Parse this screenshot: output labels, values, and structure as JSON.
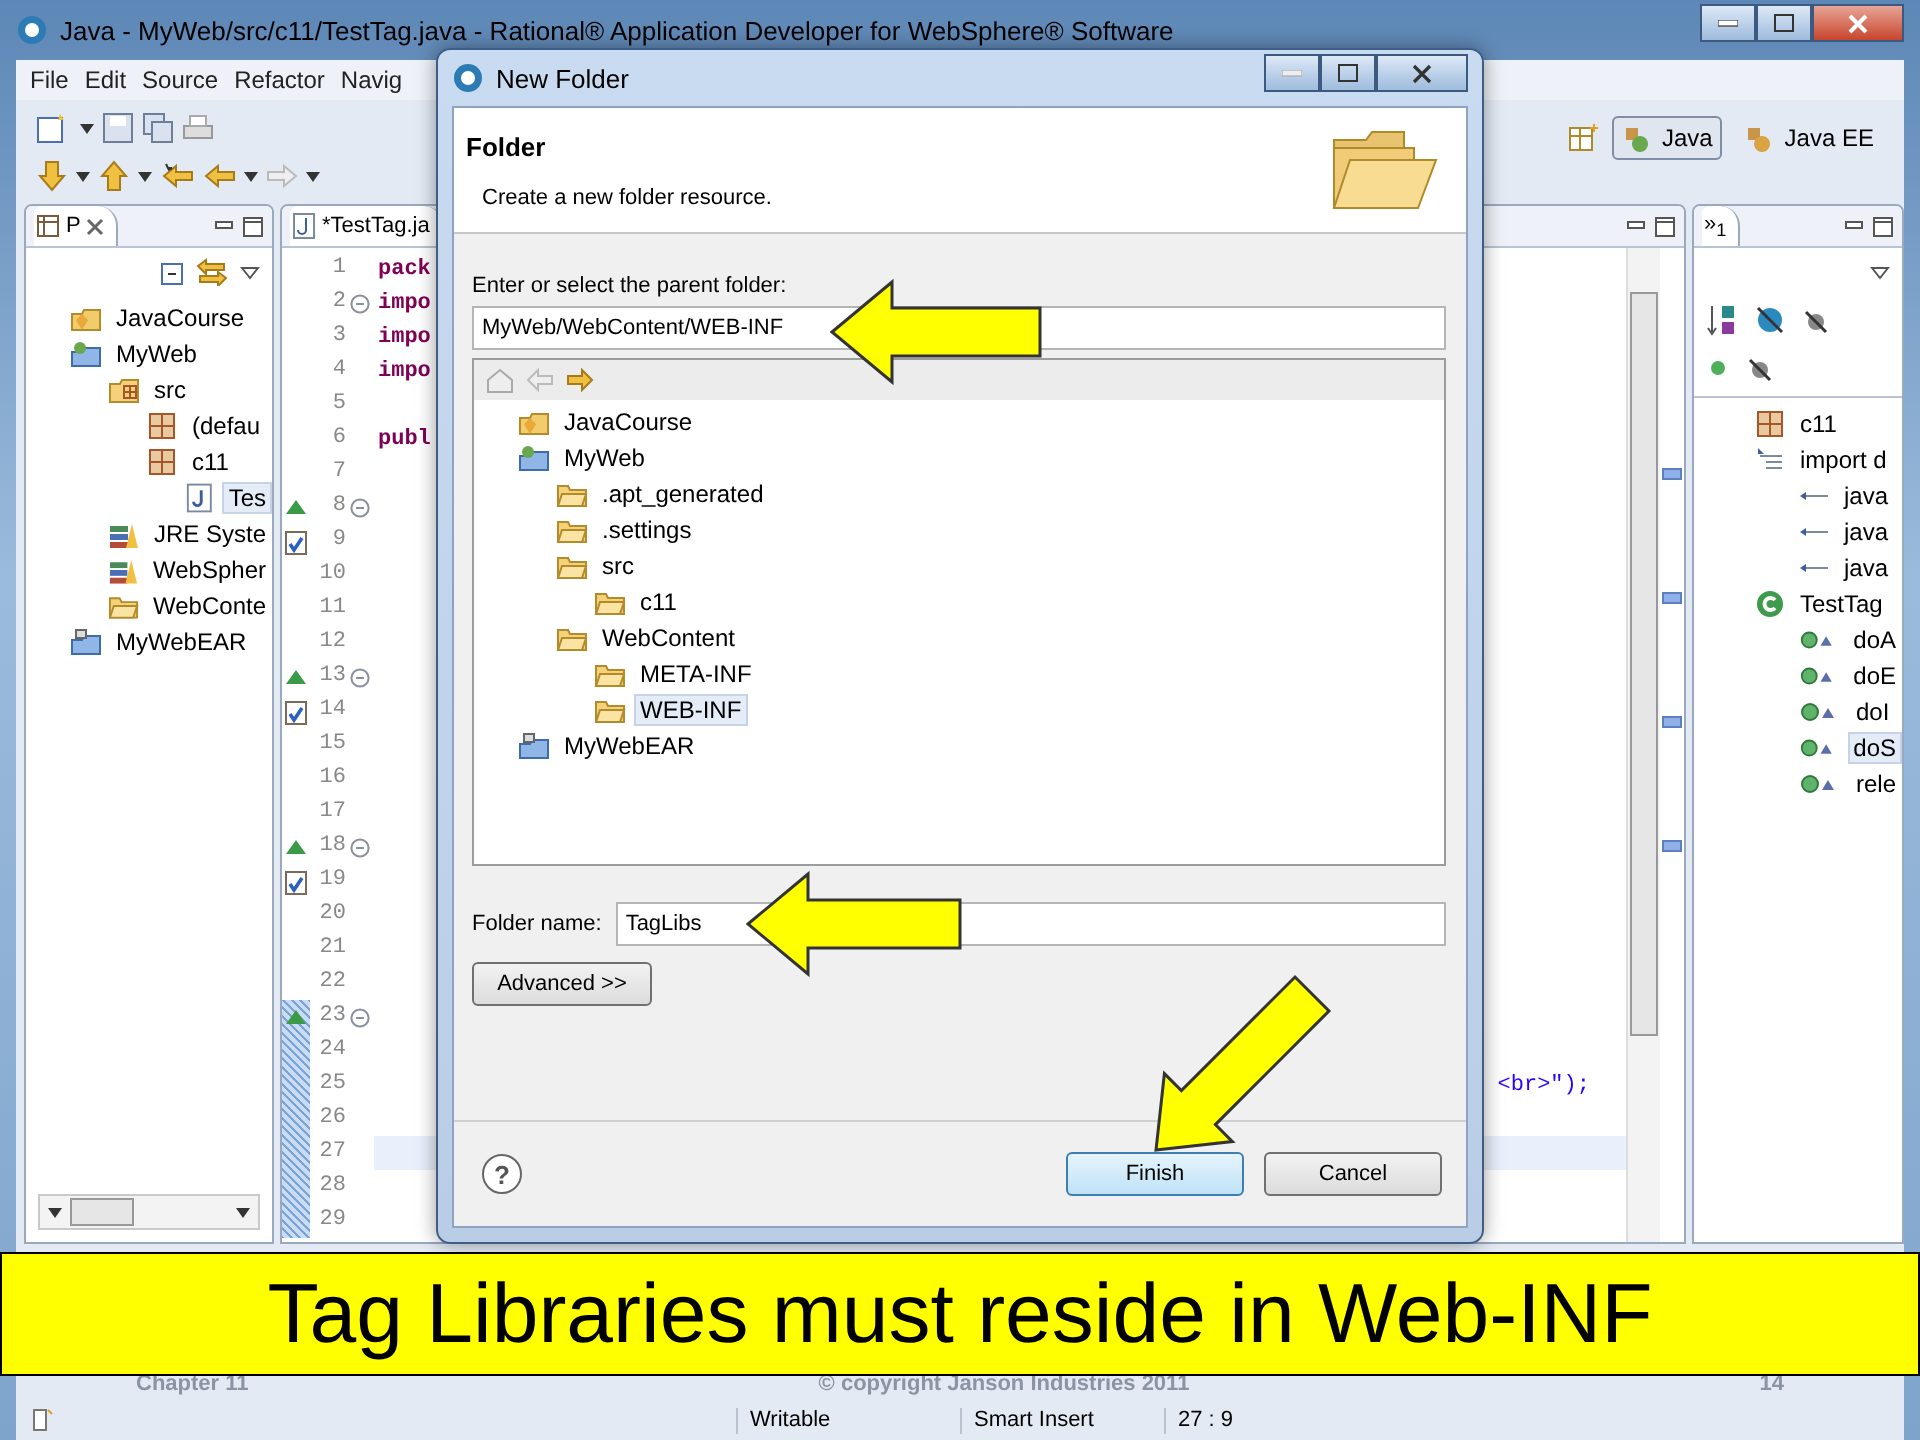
{
  "window": {
    "title": "Java - MyWeb/src/c11/TestTag.java - Rational® Application Developer for WebSphere® Software"
  },
  "menu": [
    "File",
    "Edit",
    "Source",
    "Refactor",
    "Navig"
  ],
  "perspectives": [
    {
      "label": "Java",
      "selected": true
    },
    {
      "label": "Java EE",
      "selected": false
    }
  ],
  "package_explorer": {
    "tab": "P",
    "items": [
      {
        "label": "JavaCourse",
        "kind": "project",
        "selected": false
      },
      {
        "label": "MyWeb",
        "kind": "web-project",
        "selected": false,
        "children": [
          {
            "label": "src",
            "kind": "source-folder",
            "selected": false,
            "children": [
              {
                "label": "(defau",
                "kind": "package",
                "selected": false
              },
              {
                "label": "c11",
                "kind": "package",
                "selected": false,
                "children": [
                  {
                    "label": "Tes",
                    "kind": "java-file",
                    "selected": true
                  }
                ]
              }
            ]
          },
          {
            "label": "JRE Syste",
            "kind": "library",
            "selected": false
          },
          {
            "label": "WebSpher",
            "kind": "library",
            "selected": false
          },
          {
            "label": "WebConte",
            "kind": "folder",
            "selected": false
          }
        ]
      },
      {
        "label": "MyWebEAR",
        "kind": "ear-project",
        "selected": false
      }
    ]
  },
  "editor": {
    "tab": "*TestTag.ja",
    "lines": [
      {
        "number": "1",
        "kind": "plain",
        "code": "pack",
        "fold": false,
        "current": false,
        "range": false
      },
      {
        "number": "2",
        "kind": "plain",
        "code": "impo",
        "fold": true,
        "current": false,
        "range": false
      },
      {
        "number": "3",
        "kind": "plain",
        "code": "impo",
        "fold": false,
        "current": false,
        "range": false
      },
      {
        "number": "4",
        "kind": "plain",
        "code": "impo",
        "fold": false,
        "current": false,
        "range": false
      },
      {
        "number": "5",
        "kind": "plain",
        "fold": false,
        "current": false,
        "range": false
      },
      {
        "number": "6",
        "kind": "plain",
        "code": "publ",
        "fold": false,
        "current": false,
        "range": false
      },
      {
        "number": "7",
        "kind": "plain",
        "fold": false,
        "current": false,
        "range": false
      },
      {
        "number": "8",
        "kind": "override",
        "fold": true,
        "current": false,
        "range": false
      },
      {
        "number": "9",
        "kind": "task",
        "fold": false,
        "current": false,
        "range": false
      },
      {
        "number": "10",
        "kind": "plain",
        "fold": false,
        "current": false,
        "range": false
      },
      {
        "number": "11",
        "kind": "plain",
        "fold": false,
        "current": false,
        "range": false
      },
      {
        "number": "12",
        "kind": "plain",
        "fold": false,
        "current": false,
        "range": false
      },
      {
        "number": "13",
        "kind": "override",
        "fold": true,
        "current": false,
        "range": false
      },
      {
        "number": "14",
        "kind": "task",
        "fold": false,
        "current": false,
        "range": false
      },
      {
        "number": "15",
        "kind": "plain",
        "fold": false,
        "current": false,
        "range": false
      },
      {
        "number": "16",
        "kind": "plain",
        "fold": false,
        "current": false,
        "range": false
      },
      {
        "number": "17",
        "kind": "plain",
        "fold": false,
        "current": false,
        "range": false
      },
      {
        "number": "18",
        "kind": "override",
        "fold": true,
        "current": false,
        "range": false
      },
      {
        "number": "19",
        "kind": "task",
        "fold": false,
        "current": false,
        "range": false
      },
      {
        "number": "20",
        "kind": "plain",
        "fold": false,
        "current": false,
        "range": false
      },
      {
        "number": "21",
        "kind": "plain",
        "fold": false,
        "current": false,
        "range": false
      },
      {
        "number": "22",
        "kind": "plain",
        "fold": false,
        "current": false,
        "range": false
      },
      {
        "number": "23",
        "kind": "override",
        "fold": true,
        "current": false,
        "range": true
      },
      {
        "number": "24",
        "kind": "plain",
        "fold": false,
        "current": false,
        "range": true
      },
      {
        "number": "25",
        "kind": "plain",
        "tail": "<br>\");",
        "fold": false,
        "current": false,
        "range": true
      },
      {
        "number": "26",
        "kind": "plain",
        "fold": false,
        "current": false,
        "range": true
      },
      {
        "number": "27",
        "kind": "plain",
        "fold": false,
        "current": true,
        "range": true
      },
      {
        "number": "28",
        "kind": "plain",
        "fold": false,
        "current": false,
        "range": true
      },
      {
        "number": "29",
        "kind": "plain",
        "fold": false,
        "current": false,
        "range": true
      }
    ]
  },
  "outline": {
    "chevron": "»",
    "hidden_count": "1",
    "items": [
      {
        "label": "c11",
        "kind": "package",
        "selected": false
      },
      {
        "label": "import d",
        "kind": "imports",
        "selected": false,
        "children": [
          {
            "label": "java",
            "kind": "import",
            "selected": false
          },
          {
            "label": "java",
            "kind": "import",
            "selected": false
          },
          {
            "label": "java",
            "kind": "import",
            "selected": false
          }
        ]
      },
      {
        "label": "TestTag",
        "kind": "class",
        "selected": false,
        "children": [
          {
            "label": "doA",
            "kind": "method",
            "selected": false
          },
          {
            "label": "doE",
            "kind": "method",
            "selected": false
          },
          {
            "label": "doI",
            "kind": "method",
            "selected": false
          },
          {
            "label": "doS",
            "kind": "method",
            "selected": true
          },
          {
            "label": "rele",
            "kind": "method",
            "selected": false
          }
        ]
      }
    ]
  },
  "dialog": {
    "title": "New Folder",
    "heading": "Folder",
    "description": "Create a new folder resource.",
    "parent_label": "Enter or select the parent folder:",
    "parent_value": "MyWeb/WebContent/WEB-INF",
    "tree": [
      {
        "label": "JavaCourse",
        "kind": "project",
        "selected": false
      },
      {
        "label": "MyWeb",
        "kind": "web-project",
        "selected": false,
        "children": [
          {
            "label": ".apt_generated",
            "kind": "folder",
            "selected": false
          },
          {
            "label": ".settings",
            "kind": "folder",
            "selected": false
          },
          {
            "label": "src",
            "kind": "folder",
            "selected": false,
            "children": [
              {
                "label": "c11",
                "kind": "folder",
                "selected": false
              }
            ]
          },
          {
            "label": "WebContent",
            "kind": "folder",
            "selected": false,
            "children": [
              {
                "label": "META-INF",
                "kind": "folder",
                "selected": false
              },
              {
                "label": "WEB-INF",
                "kind": "folder",
                "selected": true
              }
            ]
          }
        ]
      },
      {
        "label": "MyWebEAR",
        "kind": "ear-project",
        "selected": false
      }
    ],
    "folder_name_label": "Folder name:",
    "folder_name_value": "TagLibs",
    "advanced_button": "Advanced >>",
    "help": "?",
    "buttons": [
      {
        "label": "Finish",
        "default": true
      },
      {
        "label": "Cancel",
        "default": false
      }
    ]
  },
  "banner": "Tag Libraries must reside in Web-INF",
  "slide_footer": {
    "chapter": "Chapter 11",
    "copyright": "© copyright Janson Industries 2011",
    "page": "14"
  },
  "status_bar": [
    "Writable",
    "Smart Insert",
    "27 : 9"
  ]
}
